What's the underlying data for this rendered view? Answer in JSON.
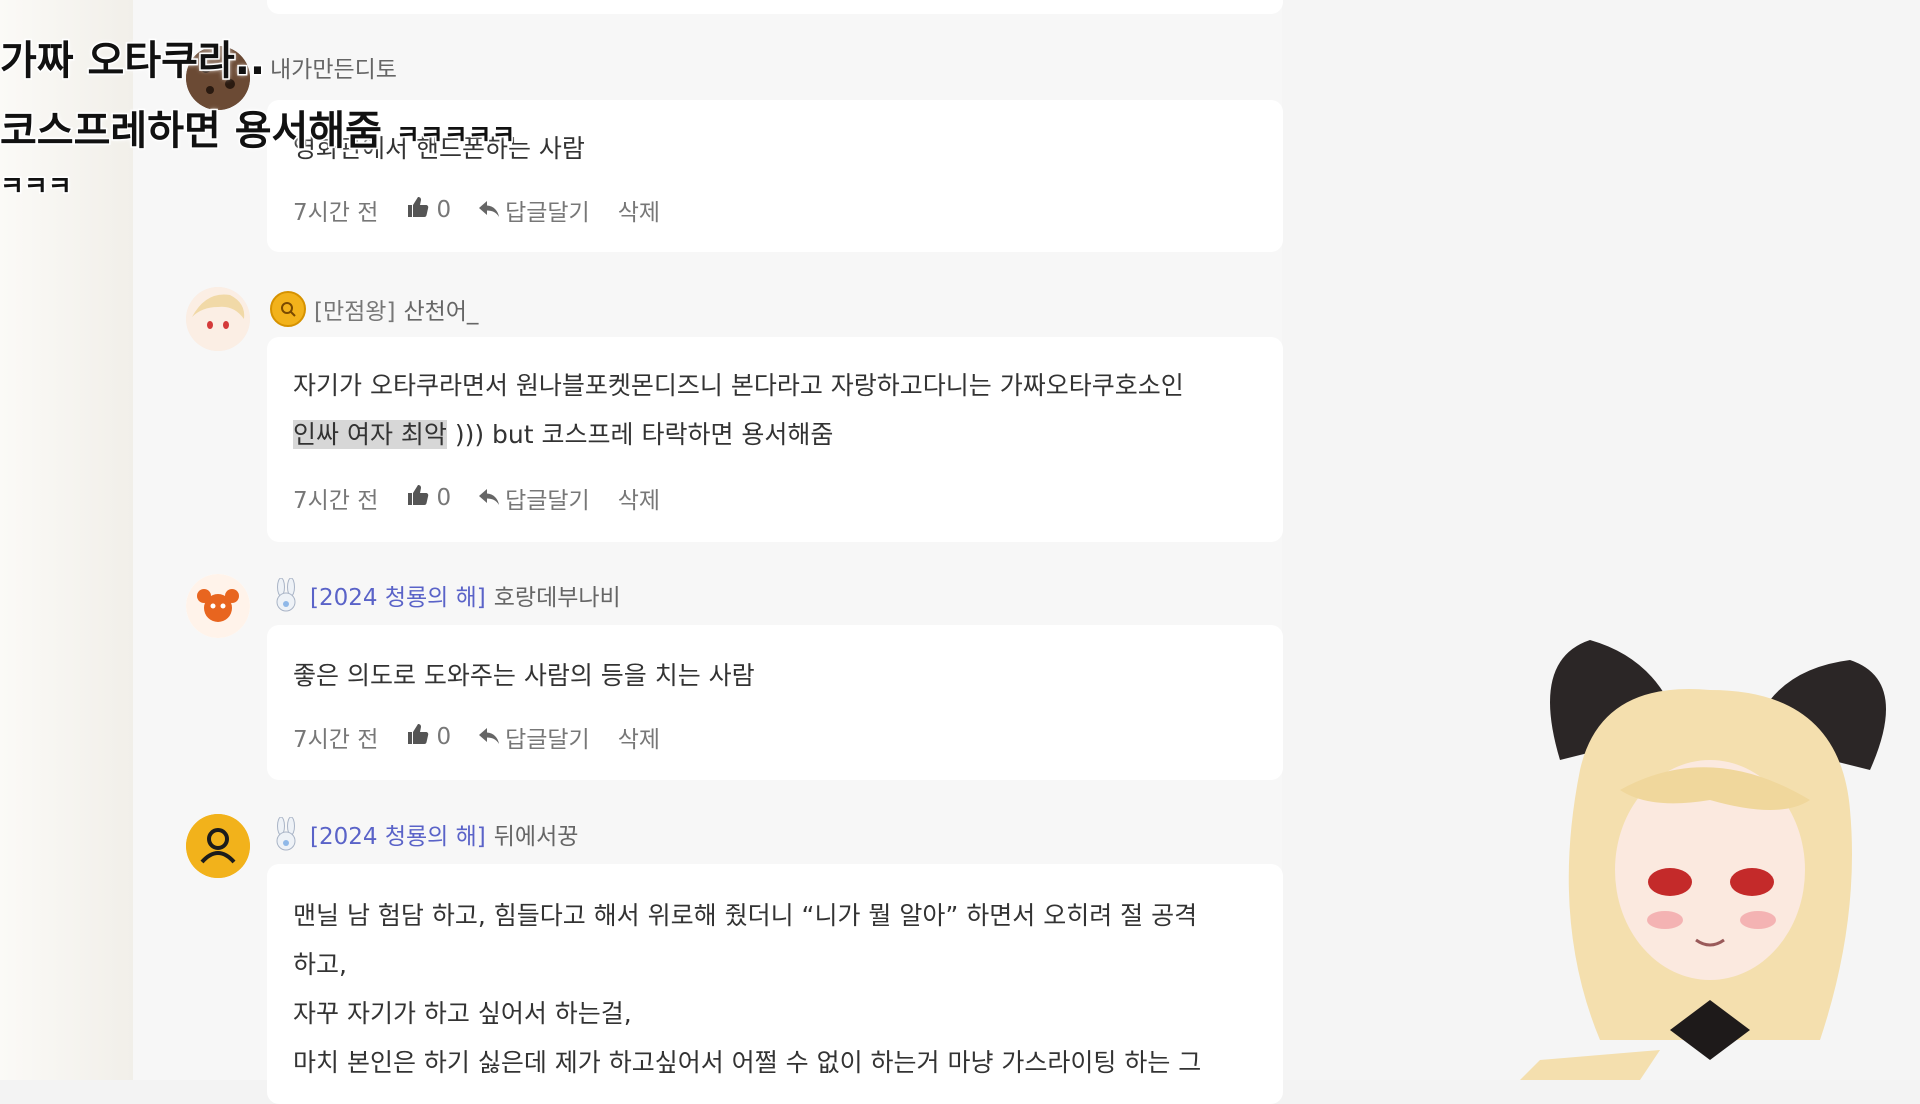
{
  "subtitles": {
    "line1": "가짜 오타쿠라..",
    "line2": "코스프레하면 용서해줌",
    "line2_laugh": "ㅋㅋㅋㅋㅋ",
    "line3": "ㅋㅋㅋ"
  },
  "comments": [
    {
      "author": "내가만든디토",
      "text_lines": [
        "영화관에서 핸드폰하는 사람"
      ],
      "time": "7시간 전",
      "likes": "0",
      "reply_label": "답글달기",
      "delete_label": "삭제"
    },
    {
      "badge_icon": "crown-coin-badge",
      "tag": "[만점왕]",
      "author": "산천어_",
      "text_highlight": "인싸 여자 최악",
      "text_line1": "자기가 오타쿠라면서 원나블포켓몬디즈니 본다라고 자랑하고다니는 가짜오타쿠호소인",
      "text_line2_rest": " ))) but 코스프레 타락하면 용서해줌",
      "time": "7시간 전",
      "likes": "0",
      "reply_label": "답글달기",
      "delete_label": "삭제"
    },
    {
      "badge_icon": "bunny-badge",
      "tag": "[2024 청룡의 해]",
      "author": "호랑데부나비",
      "text_lines": [
        "좋은 의도로 도와주는 사람의 등을 치는 사람"
      ],
      "time": "7시간 전",
      "likes": "0",
      "reply_label": "답글달기",
      "delete_label": "삭제"
    },
    {
      "badge_icon": "bunny-badge",
      "tag": "[2024 청룡의 해]",
      "author": "뒤에서꿍",
      "text_lines": [
        "맨닐 남 험담 하고, 힘들다고 해서 위로해 줬더니 “니가 뭘 알아” 하면서 오히려 절 공격",
        "하고,",
        "자꾸 자기가 하고 싶어서 하는걸,",
        "마치 본인은 하기 싫은데 제가 하고싶어서 어쩔 수 없이 하는거 마냥 가스라이팅 하는 그"
      ]
    }
  ],
  "colors": {
    "tag_blue": "#5a63c8",
    "badge_gold": "#f2b21b",
    "avatar_yellow": "#f2b21b"
  }
}
